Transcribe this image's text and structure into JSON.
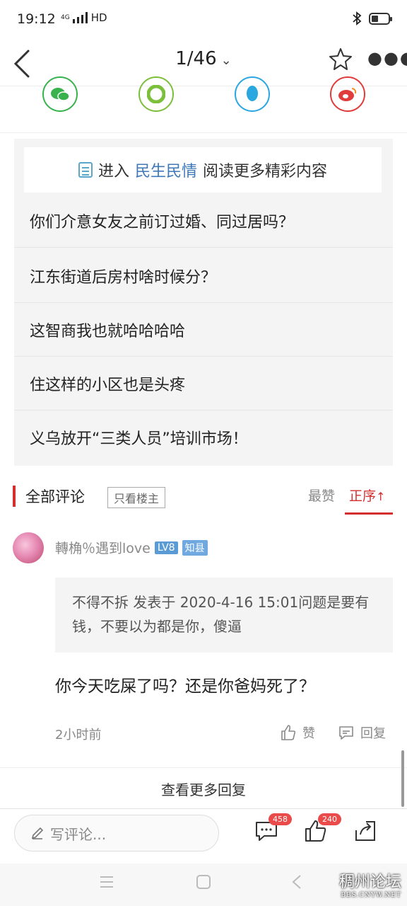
{
  "status": {
    "time": "19:12",
    "signal": "4G",
    "hd": "HD"
  },
  "nav": {
    "pager": "1/46",
    "chevron": "⌄"
  },
  "share": [
    "wechat-icon",
    "moments-icon",
    "qq-icon",
    "weibo-icon"
  ],
  "banner": {
    "prefix": "进入",
    "highlight": "民生民情",
    "suffix": "阅读更多精彩内容"
  },
  "related": [
    "你们介意女友之前订过婚、同过居吗？",
    "江东街道后房村啥时候分？",
    "这智商我也就哈哈哈哈",
    "住这样的小区也是头疼",
    "义乌放开“三类人员”培训市场！"
  ],
  "comments_header": {
    "title": "全部评论",
    "only_host": "只看楼主",
    "best": "最赞",
    "order": "正序"
  },
  "comment": {
    "user": "轉桷％遇到love",
    "level": "LV8",
    "badge": "知县",
    "quote": "不得不拆 发表于 2020-4-16 15:01问题是要有钱，不要以为都是你，傻逼",
    "text": "你今天吃屎了吗？还是你爸妈死了？",
    "time": "2小时前",
    "like_label": "赞",
    "reply_label": "回复"
  },
  "more_replies": "查看更多回复",
  "bottom": {
    "placeholder": "写评论...",
    "comment_count": "458",
    "like_count": "240"
  },
  "watermark": {
    "title": "稠州论坛",
    "url": "BBS.CNYW.NET"
  },
  "colors": {
    "accent": "#d32f2f",
    "link": "#3e78b8",
    "lv": "#5b9bd5",
    "zhixian": "#6fa9e0"
  }
}
